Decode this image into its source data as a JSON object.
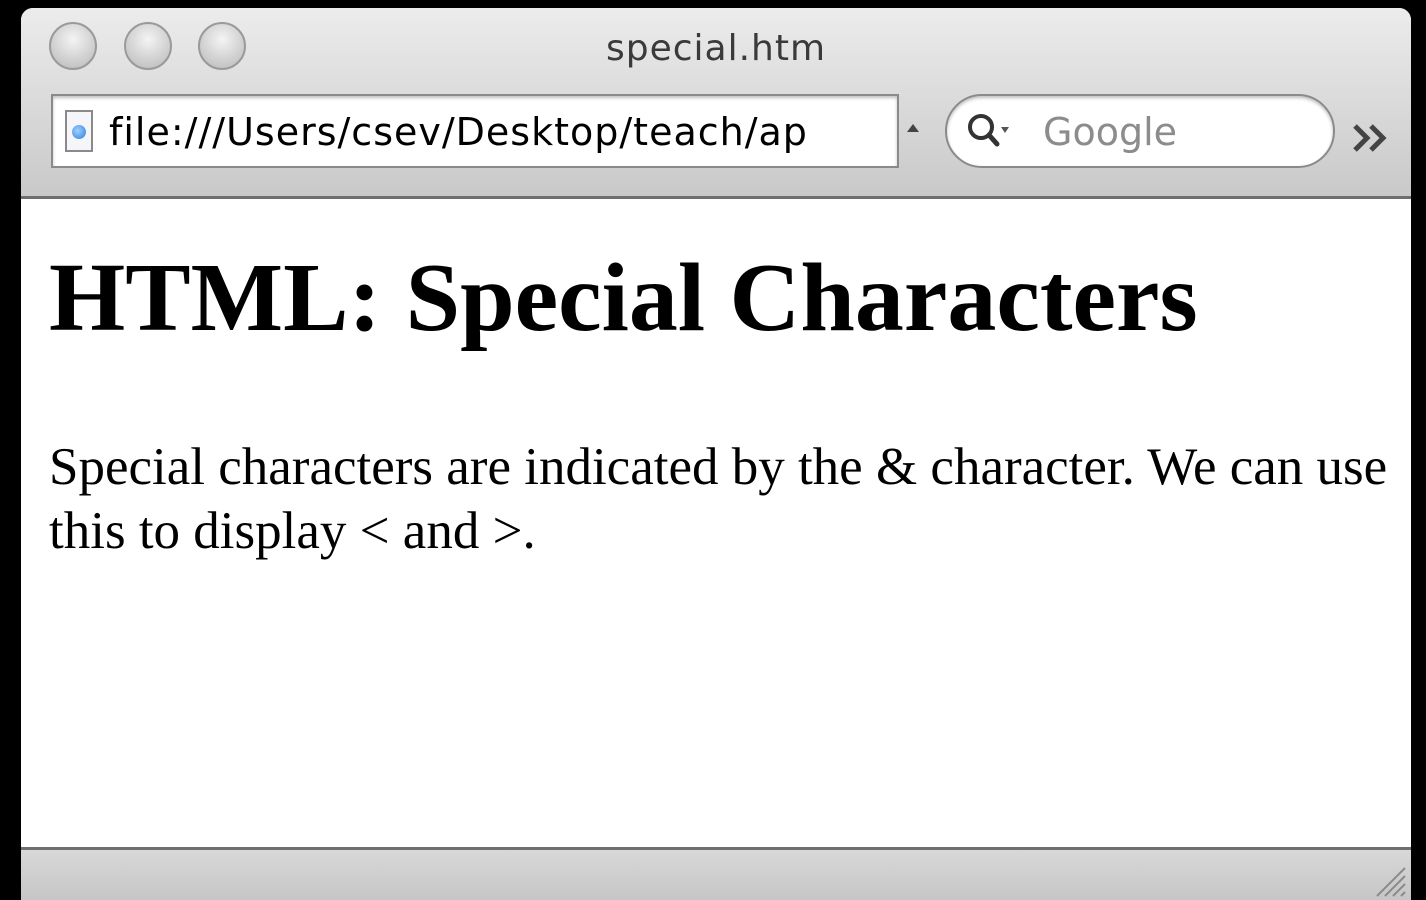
{
  "window": {
    "title": "special.htm"
  },
  "toolbar": {
    "url": "file:///Users/csev/Desktop/teach/ap",
    "search_placeholder": "Google"
  },
  "page": {
    "heading": "HTML: Special Characters",
    "paragraph": "Special characters are indicated by the & character. We can use this to display < and >."
  }
}
